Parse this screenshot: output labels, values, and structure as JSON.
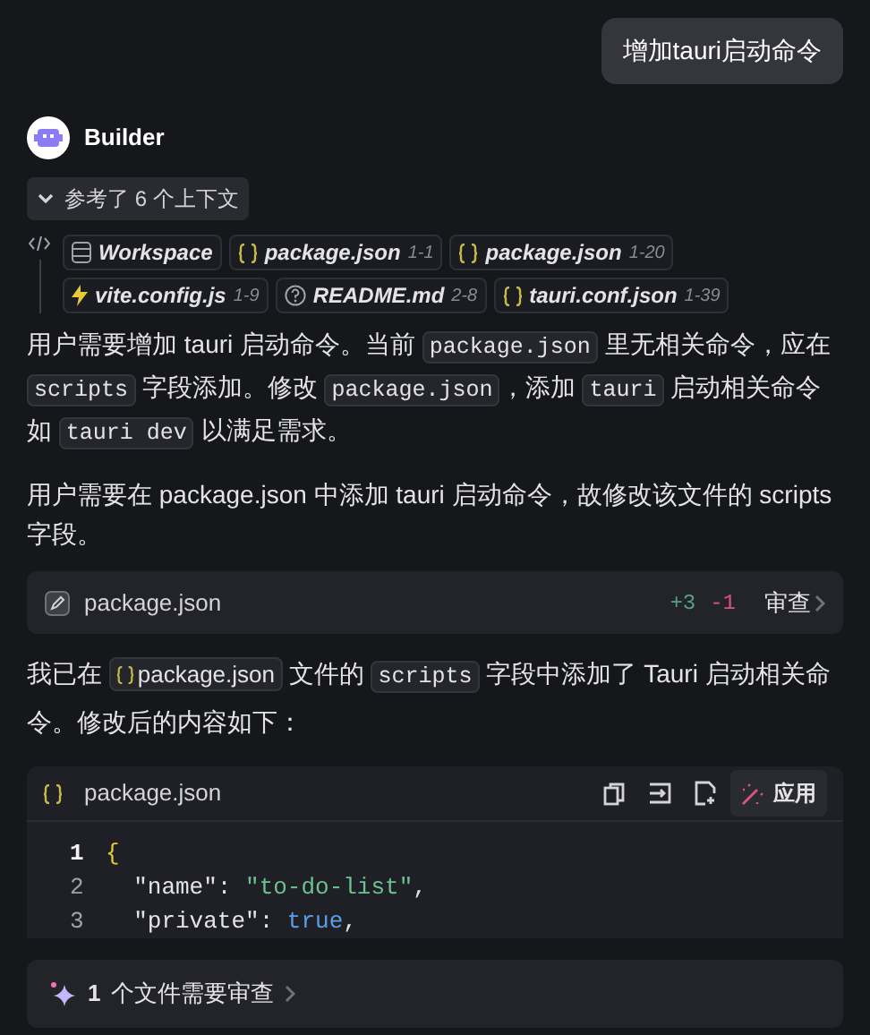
{
  "user_message": "增加tauri启动命令",
  "assistant": {
    "name": "Builder"
  },
  "context_toggle": {
    "label": "参考了 6 个上下文",
    "expanded": true
  },
  "context_chips": [
    {
      "kind": "folder",
      "name": "Workspace"
    },
    {
      "kind": "json",
      "name": "package.json",
      "range": "1-1"
    },
    {
      "kind": "json",
      "name": "package.json",
      "range": "1-20"
    },
    {
      "kind": "bolt",
      "name": "vite.config.js",
      "range": "1-9"
    },
    {
      "kind": "info",
      "name": "README.md",
      "range": "2-8"
    },
    {
      "kind": "json",
      "name": "tauri.conf.json",
      "range": "1-39"
    }
  ],
  "paragraphs": [
    [
      {
        "kind": "text",
        "text": "用户需要增加 tauri 启动命令。当前 "
      },
      {
        "kind": "code",
        "text": "package.json"
      },
      {
        "kind": "text",
        "text": " 里无相关命令，应在 "
      },
      {
        "kind": "code",
        "text": "scripts"
      },
      {
        "kind": "text",
        "text": " 字段添加。修改 "
      },
      {
        "kind": "code",
        "text": "package.json"
      },
      {
        "kind": "text",
        "text": "，添加 "
      },
      {
        "kind": "code",
        "text": "tauri"
      },
      {
        "kind": "text",
        "text": " 启动相关命令如 "
      },
      {
        "kind": "code",
        "text": "tauri dev"
      },
      {
        "kind": "text",
        "text": " 以满足需求。"
      }
    ],
    [
      {
        "kind": "text",
        "text": "用户需要在 package.json 中添加 tauri 启动命令，故修改该文件的 scripts 字段。"
      }
    ]
  ],
  "file_change": {
    "name": "package.json",
    "added": "+3",
    "removed": "-1",
    "action": "审查"
  },
  "summary": [
    {
      "kind": "text",
      "text": "我已在 "
    },
    {
      "kind": "file",
      "text": "package.json"
    },
    {
      "kind": "text",
      "text": " 文件的 "
    },
    {
      "kind": "code",
      "text": "scripts"
    },
    {
      "kind": "text",
      "text": " 字段中添加了 Tauri 启动相关命令。修改后的内容如下："
    }
  ],
  "code_block": {
    "file": "package.json",
    "apply": "应用",
    "lines": [
      {
        "number": "1",
        "current": true,
        "tokens": [
          {
            "kind": "brace",
            "text": "{"
          }
        ]
      },
      {
        "number": "2",
        "current": false,
        "tokens": [
          {
            "kind": "plain",
            "text": "  \"name\": "
          },
          {
            "kind": "string",
            "text": "\"to-do-list\""
          },
          {
            "kind": "plain",
            "text": ","
          }
        ]
      },
      {
        "number": "3",
        "current": false,
        "tokens": [
          {
            "kind": "plain",
            "text": "  \"private\": "
          },
          {
            "kind": "keyword",
            "text": "true"
          },
          {
            "kind": "plain",
            "text": ","
          }
        ]
      }
    ]
  },
  "review_bar": {
    "count": "1",
    "label": "个文件需要审查"
  }
}
